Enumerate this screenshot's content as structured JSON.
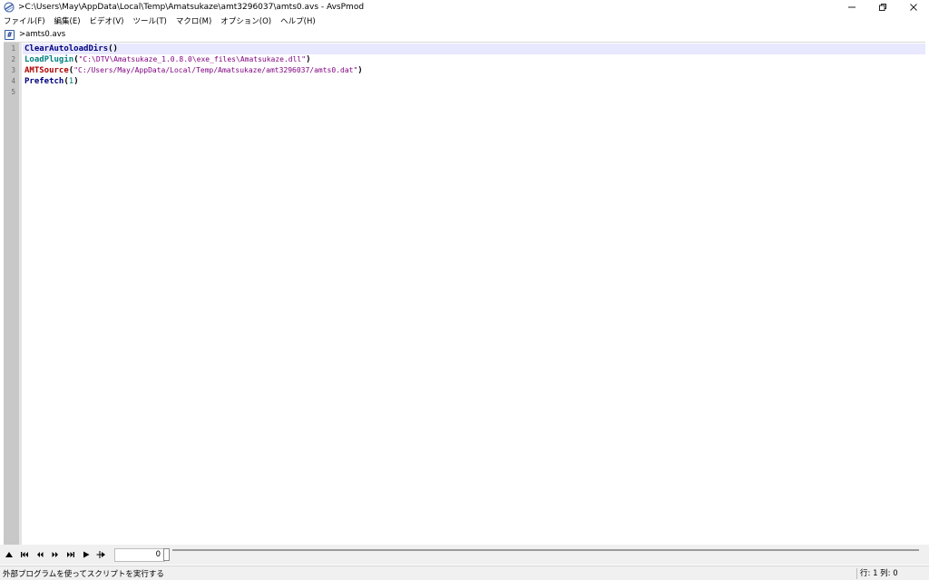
{
  "window": {
    "title": ">C:\\Users\\May\\AppData\\Local\\Temp\\Amatsukaze\\amt3296037\\amts0.avs - AvsPmod"
  },
  "menu": [
    "ファイル(F)",
    "編集(E)",
    "ビデオ(V)",
    "ツール(T)",
    "マクロ(M)",
    "オプション(O)",
    "ヘルプ(H)"
  ],
  "tab": {
    "icon": "#",
    "label": ">amts0.avs"
  },
  "editor": {
    "line_numbers": [
      "1",
      "2",
      "3",
      "4",
      "5"
    ],
    "lines": [
      {
        "fn": "ClearAutoloadDirs",
        "open": "(",
        "arg": "",
        "close": ")"
      },
      {
        "fn": "LoadPlugin",
        "open": "(",
        "arg": "\"C:\\DTV\\Amatsukaze_1.0.8.0\\exe_files\\Amatsukaze.dll\"",
        "close": ")"
      },
      {
        "fn": "AMTSource",
        "open": "(",
        "arg": "\"C:/Users/May/AppData/Local/Temp/Amatsukaze/amt3296037/amts0.dat\"",
        "close": ")"
      },
      {
        "fn": "Prefetch",
        "open": "(",
        "arg": "1",
        "close": ")"
      }
    ],
    "colors": {
      "fn_navy": "#00007f",
      "fn_teal": "#008080",
      "fn_red": "#b00000",
      "string": "#7f007f",
      "number": "#007f7f",
      "current_line": "#e8e8ff"
    }
  },
  "toolbar": {
    "buttons": [
      "toggle-preview-icon",
      "skip-to-start-icon",
      "step-back-icon",
      "step-forward-icon",
      "skip-to-end-icon",
      "play-icon",
      "run-external-icon"
    ],
    "frame_value": "0"
  },
  "status": {
    "message": "外部プログラムを使ってスクリプトを実行する",
    "position": "行: 1  列: 0"
  }
}
